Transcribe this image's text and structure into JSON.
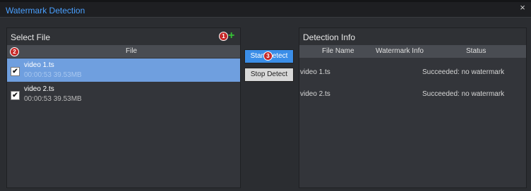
{
  "window": {
    "title": "Watermark Detection",
    "close_label": "×"
  },
  "left_panel": {
    "title": "Select File",
    "column_header": "File",
    "add_icon_label": "+",
    "files": [
      {
        "name": "video 1.ts",
        "meta": "00:00:53  39.53MB",
        "checked": true,
        "selected": true
      },
      {
        "name": "video 2.ts",
        "meta": "00:00:53  39.53MB",
        "checked": true,
        "selected": false
      }
    ]
  },
  "buttons": {
    "start_label": "Start Detect",
    "stop_label": "Stop Detect"
  },
  "right_panel": {
    "title": "Detection Info",
    "columns": [
      "File Name",
      "Watermark Info",
      "Status"
    ],
    "rows": [
      {
        "file": "video 1.ts",
        "watermark": "",
        "status": "Succeeded: no watermark"
      },
      {
        "file": "video 2.ts",
        "watermark": "",
        "status": "Succeeded: no watermark"
      }
    ]
  },
  "annotations": [
    "1",
    "2",
    "3"
  ],
  "check_mark": "✔",
  "colors": {
    "accent": "#3b8ee8",
    "title_text": "#4aa0ff",
    "selected_row": "#6f9fdf",
    "add_icon": "#35c135",
    "badge": "#c62828"
  }
}
